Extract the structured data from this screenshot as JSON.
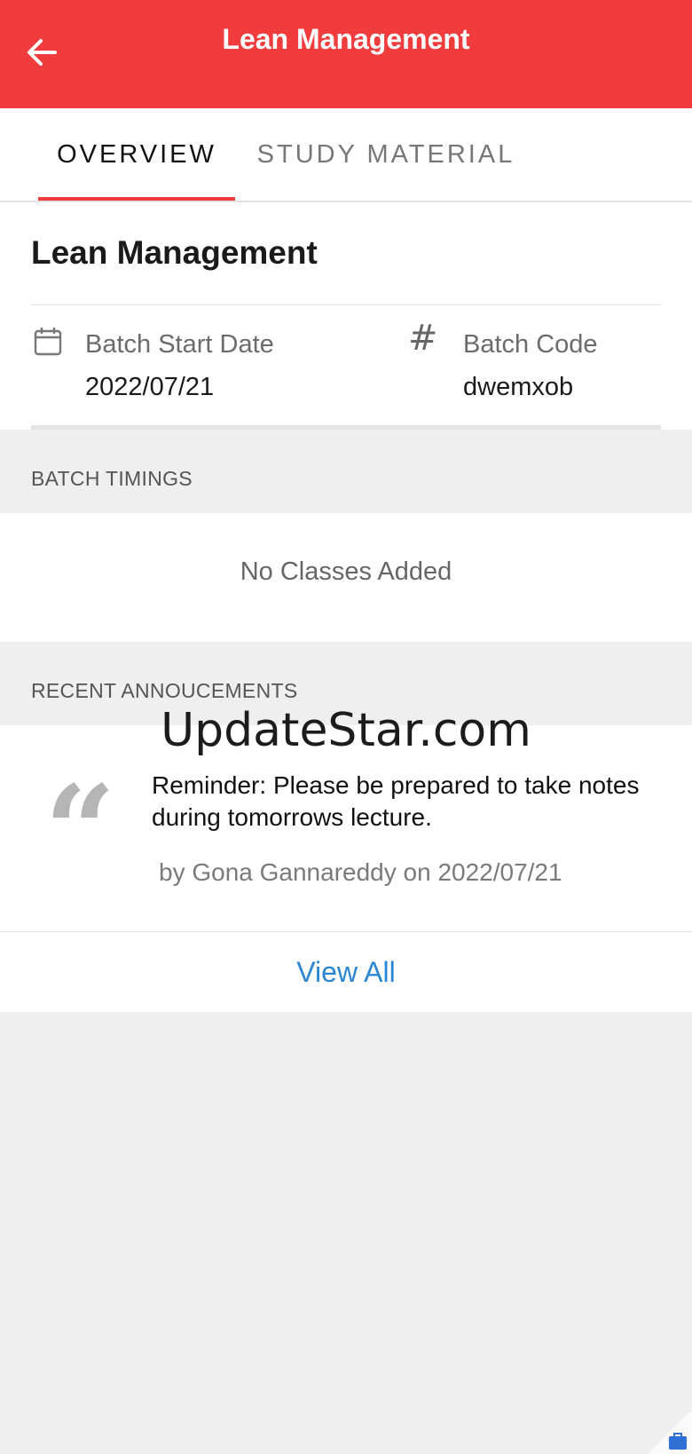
{
  "appbar": {
    "title": "Lean Management",
    "color": "#f03c3c"
  },
  "tabs": [
    {
      "label": "OVERVIEW",
      "active": true
    },
    {
      "label": "STUDY MATERIAL",
      "active": false
    }
  ],
  "overview": {
    "course_title": "Lean Management",
    "batch_start": {
      "label": "Batch Start Date",
      "value": "2022/07/21",
      "icon": "calendar-icon"
    },
    "batch_code": {
      "label": "Batch Code",
      "value": "dwemxob",
      "icon": "hash-icon"
    }
  },
  "batch_timings": {
    "header": "BATCH TIMINGS",
    "empty_text": "No Classes Added"
  },
  "announcements": {
    "header": "RECENT ANNOUCEMENTS",
    "items": [
      {
        "text": "Reminder: Please be prepared to take notes during tomorrows lecture.",
        "meta": "by Gona Gannareddy on 2022/07/21"
      }
    ],
    "view_all_label": "View All",
    "link_color": "#2a86d0"
  },
  "watermark": "UpdateStar.com"
}
